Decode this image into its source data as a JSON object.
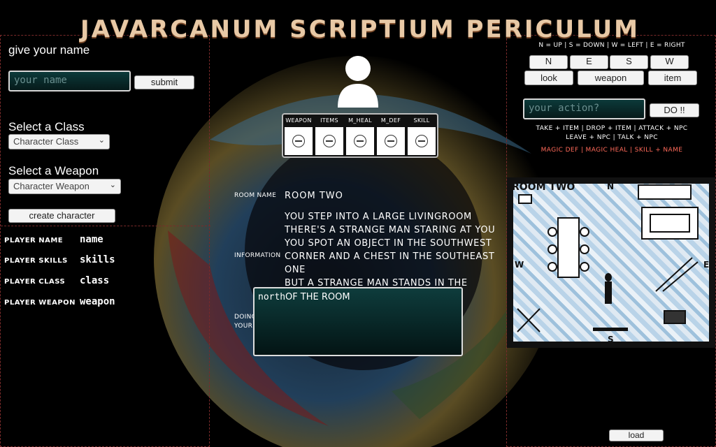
{
  "title": "JAVARCANUM SCRIPTIUM PERICULUM",
  "left": {
    "name_heading": "give your name",
    "name_placeholder": "your name",
    "submit_label": "submit",
    "class_heading": "Select a Class",
    "class_select": "Character Class",
    "weapon_heading": "Select a Weapon",
    "weapon_select": "Character Weapon",
    "create_label": "create character",
    "stats": [
      {
        "key": "PLAYER NAME",
        "value": "name"
      },
      {
        "key": "PLAYER SKILLS",
        "value": "skills"
      },
      {
        "key": "PLAYER CLASS",
        "value": "class"
      },
      {
        "key": "PLAYER WEAPON",
        "value": "weapon"
      }
    ]
  },
  "center": {
    "slots": [
      "WEAPON",
      "ITEMS",
      "M_HEAL",
      "M_DEF",
      "SKILL"
    ],
    "room_name_label": "ROOM NAME",
    "room_name_value": "ROOM TWO",
    "information_label": "INFORMATION",
    "information_lines": [
      "YOU STEP INTO A LARGE LIVINGROOM",
      "THERE'S A STRANGE MAN STARING AT YOU",
      "YOU SPOT AN OBJECT IN THE SOUTHWEST",
      "CORNER AND A CHEST IN THE SOUTHEAST",
      "ONE",
      "BUT A STRANGE MAN STANDS IN THE MIDDLE"
    ],
    "doing_label": "DOING YOUR THING",
    "doing_text": "north",
    "overlap_text": "OF THE ROOM"
  },
  "right": {
    "legend": "N = UP | S = DOWN | W = LEFT | E = RIGHT",
    "directions": [
      "N",
      "E",
      "S",
      "W"
    ],
    "actions": [
      "look",
      "weapon",
      "item"
    ],
    "action_placeholder": "your action?",
    "do_label": "DO !!",
    "help_line1": "TAKE + ITEM | DROP + ITEM | ATTACK + NPC",
    "help_line2": "LEAVE + NPC | TALK + NPC",
    "magic_line": "MAGIC DEF | MAGIC HEAL | SKILL + NAME",
    "map_title": "ROOM TWO",
    "map_compass": [
      "N",
      "S",
      "W",
      "E"
    ],
    "load_label": "load"
  },
  "colors": {
    "accent_red": "#ff6a5a",
    "title": "#e8c9a6",
    "input_bg": "#0c3a3a"
  }
}
